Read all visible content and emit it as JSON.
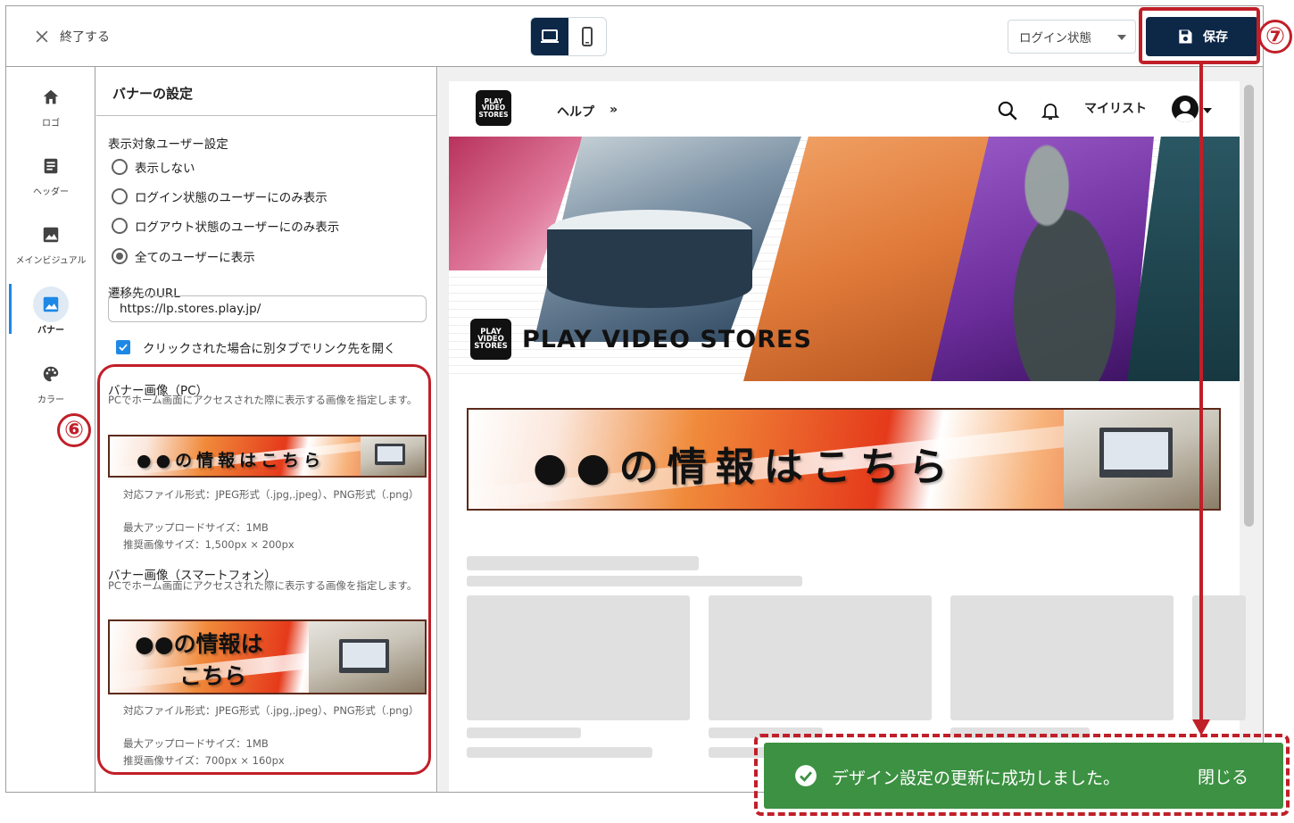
{
  "topbar": {
    "close_label": "終了する",
    "device_options": [
      "desktop",
      "mobile"
    ],
    "device_selected": "desktop",
    "login_state_select": "ログイン状態",
    "save_label": "保存"
  },
  "leftnav": {
    "items": [
      {
        "label": "ロゴ",
        "icon": "home-icon",
        "active": false
      },
      {
        "label": "ヘッダー",
        "icon": "article-icon",
        "active": false
      },
      {
        "label": "メインビジュアル",
        "icon": "image-icon",
        "active": false
      },
      {
        "label": "バナー",
        "icon": "banner-image-icon",
        "active": true
      },
      {
        "label": "カラー",
        "icon": "palette-icon",
        "active": false
      }
    ]
  },
  "panel": {
    "title": "バナーの設定",
    "target_users": {
      "label": "表示対象ユーザー設定",
      "options": [
        {
          "label": "表示しない",
          "checked": false
        },
        {
          "label": "ログイン状態のユーザーにのみ表示",
          "checked": false
        },
        {
          "label": "ログアウト状態のユーザーにのみ表示",
          "checked": false
        },
        {
          "label": "全てのユーザーに表示",
          "checked": true
        }
      ]
    },
    "url": {
      "label": "遷移先のURL",
      "value": "https://lp.stores.play.jp/"
    },
    "new_tab": {
      "label": "クリックされた場合に別タブでリンク先を開く",
      "checked": true
    },
    "pc_image": {
      "label": "バナー画像（PC）",
      "help": "PCでホーム画面にアクセスされた際に表示する画像を指定します。",
      "banner_text": "●●の情報はこちら",
      "spec_format": "対応ファイル形式：JPEG形式（.jpg,.jpeg）、PNG形式（.png）",
      "spec_maxsize": "最大アップロードサイズ：1MB",
      "spec_recommended": "推奨画像サイズ：1,500px × 200px"
    },
    "sp_image": {
      "label": "バナー画像（スマートフォン）",
      "help": "PCでホーム画面にアクセスされた際に表示する画像を指定します。",
      "banner_text_line1": "●●の情報は",
      "banner_text_line2": "こちら",
      "spec_format": "対応ファイル形式：JPEG形式（.jpg,.jpeg）、PNG形式（.png）",
      "spec_maxsize": "最大アップロードサイズ：1MB",
      "spec_recommended": "推奨画像サイズ：700px × 160px"
    }
  },
  "preview": {
    "logo_lines": [
      "PLAY",
      "VIDEO",
      "STORES"
    ],
    "help_link": "ヘルプ",
    "help_arrow": "»",
    "mylist": "マイリスト",
    "hero_title": "PLAY VIDEO STORES",
    "banner_text": "●●の情報はこちら"
  },
  "toast": {
    "message": "デザイン設定の更新に成功しました。",
    "close_label": "閉じる"
  },
  "annotations": {
    "step6": "⑥",
    "step7": "⑦",
    "color": "#c01f28"
  },
  "colors": {
    "primary": "#0d2747",
    "accent": "#1e88e5",
    "success": "#3c9142"
  }
}
